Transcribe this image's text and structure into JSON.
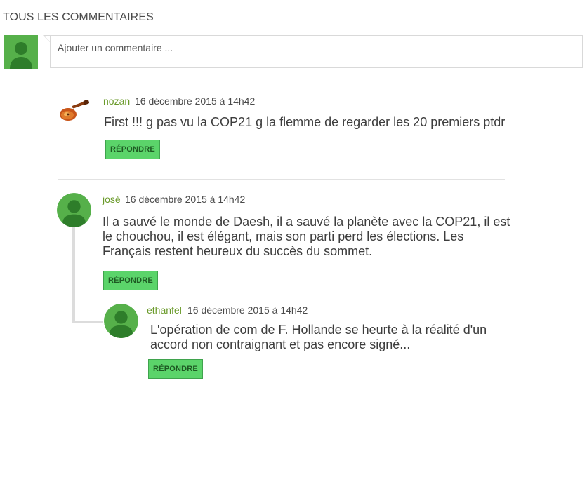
{
  "section": {
    "title": "TOUS LES COMMENTAIRES"
  },
  "composer": {
    "placeholder": "Ajouter un commentaire ..."
  },
  "comments": [
    {
      "author": "nozan",
      "date": "16 décembre 2015 à 14h42",
      "text": "First !!! g pas vu la COP21 g la flemme de regarder les 20 premiers ptdr",
      "reply_label": "RÉPONDRE",
      "avatar_icon": "guitar-icon"
    },
    {
      "author": "josé",
      "date": "16 décembre 2015 à 14h42",
      "text": "Il a sauvé le monde de Daesh, il a sauvé la planète avec la COP21, il est le chouchou, il est élégant, mais son parti perd les élections. Les Français restent heureux du succès du sommet.",
      "reply_label": "RÉPONDRE",
      "avatar_icon": "user-icon",
      "replies": [
        {
          "author": "ethanfel",
          "date": "16 décembre 2015 à 14h42",
          "text": "L'opération de com de F. Hollande se heurte à la réalité d'un accord non contraignant et pas encore signé...",
          "reply_label": "RÉPONDRE",
          "avatar_icon": "user-icon"
        }
      ]
    }
  ],
  "colors": {
    "accent_green": "#56b04a",
    "button_green": "#5bd46a",
    "author_green": "#6a9a2a"
  }
}
